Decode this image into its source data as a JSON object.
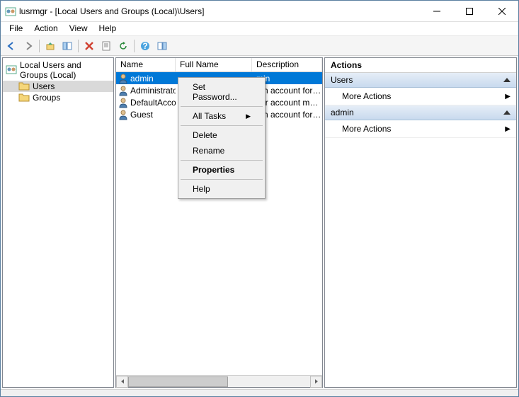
{
  "title": "lusrmgr - [Local Users and Groups (Local)\\Users]",
  "menu": {
    "file": "File",
    "action": "Action",
    "view": "View",
    "help": "Help"
  },
  "tree": {
    "root": "Local Users and Groups (Local)",
    "items": [
      {
        "label": "Users",
        "selected": true
      },
      {
        "label": "Groups",
        "selected": false
      }
    ]
  },
  "columns": {
    "name": "Name",
    "full": "Full Name",
    "desc": "Description"
  },
  "rows": [
    {
      "name": "admin",
      "full": "",
      "desc": "min",
      "selected": true
    },
    {
      "name": "Administrator",
      "full": "",
      "desc": "t-in account for adm"
    },
    {
      "name": "DefaultAcco...",
      "full": "",
      "desc": "ser account manage"
    },
    {
      "name": "Guest",
      "full": "",
      "desc": "t-in account for gue"
    }
  ],
  "context": {
    "set_pwd": "Set Password...",
    "all_tasks": "All Tasks",
    "delete": "Delete",
    "rename": "Rename",
    "properties": "Properties",
    "help": "Help"
  },
  "actions": {
    "title": "Actions",
    "group1": "Users",
    "more1": "More Actions",
    "group2": "admin",
    "more2": "More Actions"
  }
}
